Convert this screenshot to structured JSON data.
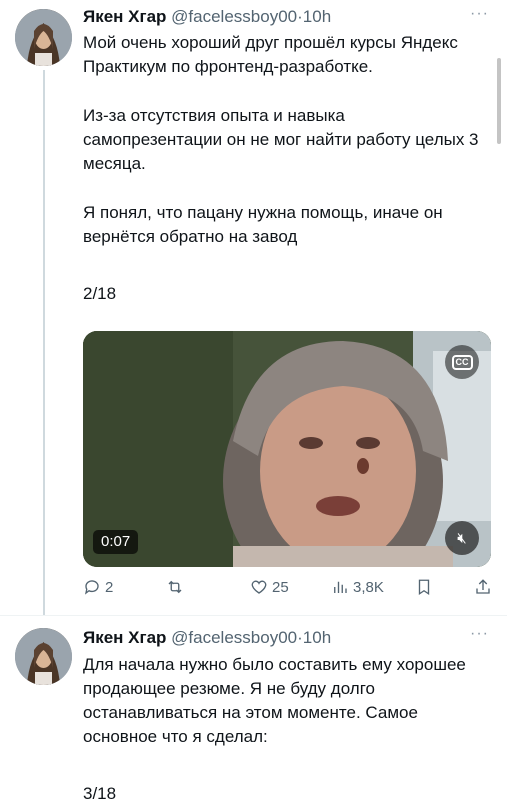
{
  "tweets": [
    {
      "author": {
        "name": "Якен Хгар",
        "handle": "@facelessboy00",
        "separator": "·",
        "time": "10h"
      },
      "text": [
        "Мой очень хороший друг прошёл курсы Яндекс Практикум по фронтенд-разработке.",
        "Из-за отсутствия опыта и навыка самопрезентации он не мог найти работу целых 3 месяца.",
        "Я понял, что пацану нужна помощь, иначе он вернётся обратно на завод"
      ],
      "counter": "2/18",
      "video": {
        "duration": "0:07",
        "cc_label": "CC",
        "mute_icon": "speaker-muted-icon"
      },
      "metrics": {
        "replies": "2",
        "retweets": "",
        "likes": "25",
        "views": "3,8K"
      }
    },
    {
      "author": {
        "name": "Якен Хгар",
        "handle": "@facelessboy00",
        "separator": "·",
        "time": "10h"
      },
      "text": [
        "Для начала нужно было составить ему хорошее продающее резюме. Я не буду долго останавливаться на этом моменте. Самое основное что я сделал:"
      ],
      "counter": "3/18"
    }
  ],
  "more_label": "···",
  "colors": {
    "text": "#0f1419",
    "secondary": "#536471",
    "thread_line": "#cfd9de"
  }
}
